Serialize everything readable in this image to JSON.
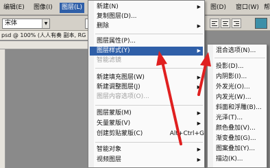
{
  "menubar": {
    "items": [
      {
        "label": "编辑(E)"
      },
      {
        "label": "图像(I)"
      },
      {
        "label": "图层(L)"
      },
      {
        "label": "图(D)"
      },
      {
        "label": "窗口(W)"
      },
      {
        "label": "帮"
      }
    ]
  },
  "options": {
    "font_family": "宋体",
    "font_size": "-"
  },
  "doc_tab": {
    "label": "psd @ 100% (人人有奏 副本, RG"
  },
  "layer_menu": {
    "items": [
      {
        "label": "新建(N)",
        "submenu": true
      },
      {
        "label": "复制图层(D)..."
      },
      {
        "label": "删除",
        "submenu": true
      },
      {
        "label": "图层属性(P)..."
      },
      {
        "label": "图层样式(Y)",
        "submenu": true,
        "highlighted": true
      },
      {
        "label": "智能滤镜",
        "disabled": true
      },
      {
        "label": "新建填充图层(W)",
        "submenu": true
      },
      {
        "label": "新建调整图层(J)",
        "submenu": true
      },
      {
        "label": "图层内容选项(O)...",
        "disabled": true
      },
      {
        "label": "图层蒙版(M)",
        "submenu": true
      },
      {
        "label": "矢量蒙版(V)",
        "submenu": true
      },
      {
        "label": "创建剪贴蒙版(C)",
        "shortcut": "Alt+Ctrl+G"
      },
      {
        "label": "智能对象",
        "submenu": true
      },
      {
        "label": "视频图层",
        "submenu": true
      }
    ]
  },
  "style_menu": {
    "items": [
      {
        "label": "混合选项(N)..."
      },
      {
        "label": "投影(D)..."
      },
      {
        "label": "内阴影(I)..."
      },
      {
        "label": "外发光(O)..."
      },
      {
        "label": "内发光(W)..."
      },
      {
        "label": "斜面和浮雕(B)..."
      },
      {
        "label": "光泽(T)..."
      },
      {
        "label": "颜色叠加(V)..."
      },
      {
        "label": "渐变叠加(G)..."
      },
      {
        "label": "图案叠加(Y)..."
      },
      {
        "label": "描边(K)..."
      }
    ]
  },
  "colors": {
    "highlight": "#2f5fa8",
    "arrow": "#e02020",
    "swatch": "#3c8fa8"
  }
}
